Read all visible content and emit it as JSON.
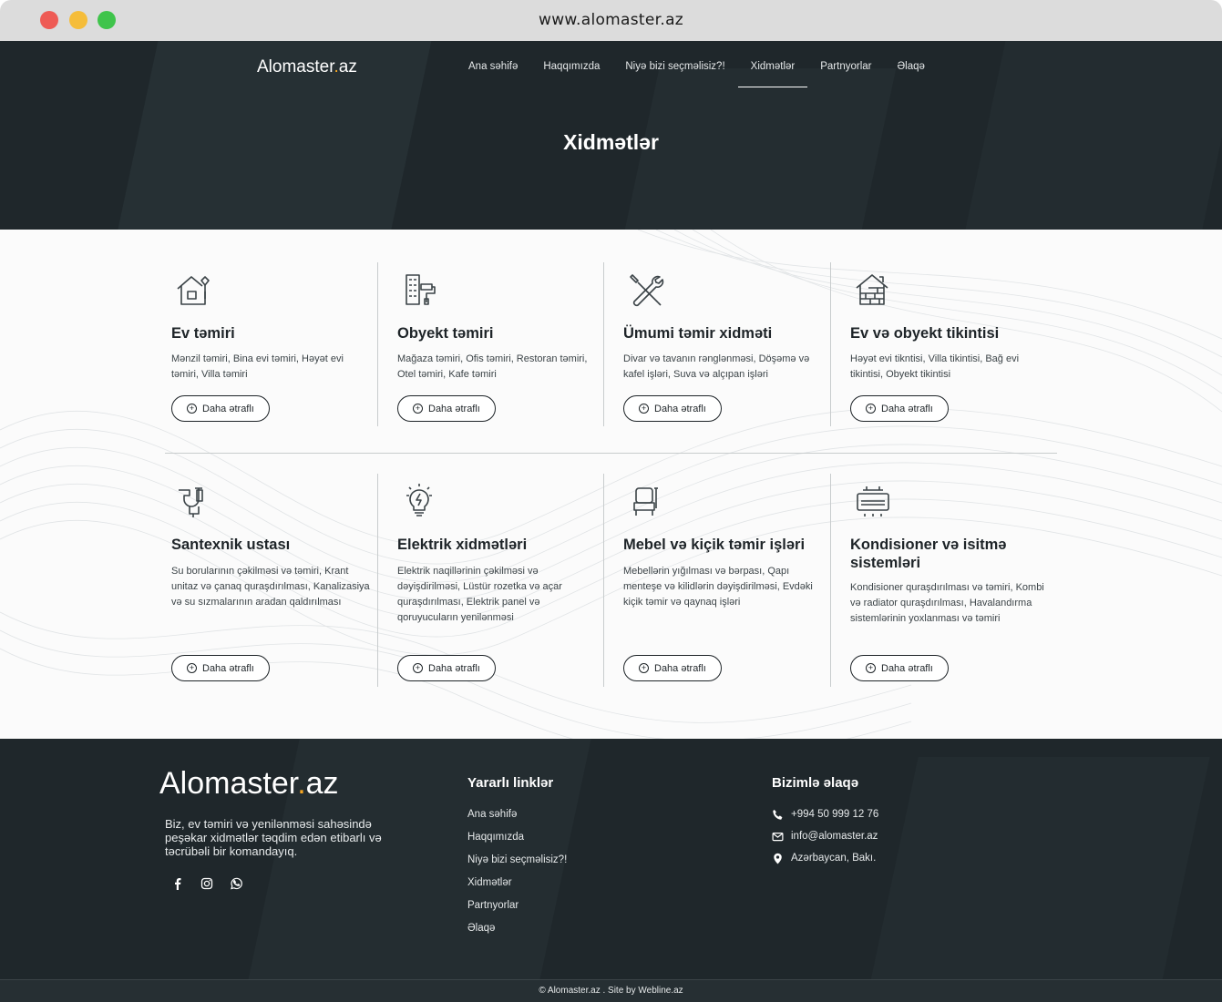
{
  "browser": {
    "url": "www.alomaster.az"
  },
  "brand": {
    "logo_main": "Alomaster",
    "logo_dot": ".",
    "logo_tld": "az",
    "accent_color": "#f5a623",
    "dark_bg": "#1f272b"
  },
  "nav": {
    "items": [
      {
        "label": "Ana səhifə"
      },
      {
        "label": "Haqqımızda"
      },
      {
        "label": "Niyə bizi seçməlisiz?!"
      },
      {
        "label": "Xidmətlər",
        "active": true
      },
      {
        "label": "Partnyorlar"
      },
      {
        "label": "Əlaqə"
      }
    ]
  },
  "hero": {
    "title": "Xidmətlər"
  },
  "services": {
    "button_label": "Daha ətraflı",
    "items": [
      {
        "icon": "house-repair-icon",
        "title": "Ev təmiri",
        "desc": "Mənzil təmiri, Bina evi təmiri, Həyət evi təmiri, Villa təmiri"
      },
      {
        "icon": "building-paint-roller-icon",
        "title": "Obyekt təmiri",
        "desc": "Mağaza təmiri, Ofis təmiri, Restoran təmiri, Otel təmiri, Kafe təmiri"
      },
      {
        "icon": "wrench-screwdriver-icon",
        "title": "Ümumi təmir xidməti",
        "desc": "Divar və tavanın rənglənməsi, Döşəmə və kafel işləri, Suva və alçıpan işləri"
      },
      {
        "icon": "house-brick-icon",
        "title": "Ev və obyekt tikintisi",
        "desc": "Həyət evi tikntisi, Villa tikintisi, Bağ evi tikintisi, Obyekt tikintisi"
      },
      {
        "icon": "pipe-faucet-icon",
        "title": "Santexnik ustası",
        "desc": "Su borularının çəkilməsi və təmiri, Krant unitaz və çanaq quraşdırılması, Kanalizasiya və su sızmalarının aradan qaldırılması"
      },
      {
        "icon": "lightbulb-bolt-icon",
        "title": "Elektrik xidmətləri",
        "desc": "Elektrik naqillərinin çəkilməsi və dəyişdirilməsi, Lüstür rozetka və açar quraşdırılması, Elektrik panel və qoruyucuların yenilənməsi"
      },
      {
        "icon": "chair-tools-icon",
        "title": "Mebel və kiçik təmir işləri",
        "desc": "Mebellərin yığılması və bərpası, Qapı menteşe və kilidlərin dəyişdirilməsi, Evdəki kiçik təmir və qaynaq işləri"
      },
      {
        "icon": "air-conditioner-icon",
        "title": "Kondisioner və isitmə sistemləri",
        "desc": "Kondisioner quraşdırılması və təmiri, Kombi və radiator quraşdırılması, Havalandırma sistemlərinin yoxlanması və təmiri"
      }
    ]
  },
  "footer": {
    "about": "Biz, ev təmiri və yenilənməsi sahəsində peşəkar xidmətlər təqdim edən etibarlı və təcrübəli bir komandayıq.",
    "socials": [
      "facebook-icon",
      "instagram-icon",
      "whatsapp-icon"
    ],
    "links_title": "Yararlı linklər",
    "links": [
      "Ana səhifə",
      "Haqqımızda",
      "Niyə bizi seçməlisiz?!",
      "Xidmətlər",
      "Partnyorlar",
      "Əlaqə"
    ],
    "contact_title": "Bizimlə əlaqə",
    "contacts": [
      {
        "icon": "phone-icon",
        "text": "+994 50 999 12 76"
      },
      {
        "icon": "mail-icon",
        "text": "info@alomaster.az"
      },
      {
        "icon": "location-pin-icon",
        "text": "Azərbaycan, Bakı."
      }
    ],
    "copyright": "© Alomaster.az . Site by Webline.az"
  }
}
